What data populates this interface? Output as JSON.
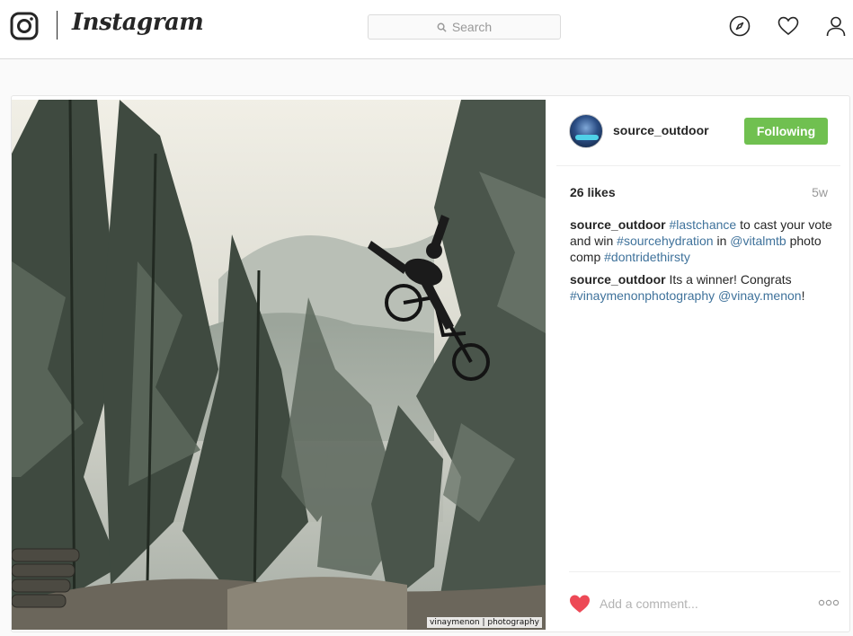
{
  "header": {
    "wordmark": "Instagram",
    "search": {
      "placeholder": "Search"
    }
  },
  "post": {
    "image_credit": "vinaymenon | photography",
    "author": "source_outdoor",
    "follow_label": "Following",
    "likes": "26 likes",
    "age": "5w",
    "comments": [
      {
        "user": "source_outdoor",
        "parts": [
          {
            "text": "#lastchance",
            "link": true
          },
          {
            "text": " to cast your vote and win ",
            "link": false
          },
          {
            "text": "#sourcehydration",
            "link": true
          },
          {
            "text": " in ",
            "link": false
          },
          {
            "text": "@vitalmtb",
            "link": true
          },
          {
            "text": " photo comp ",
            "link": false
          },
          {
            "text": "#dontridethirsty",
            "link": true
          }
        ]
      },
      {
        "user": "source_outdoor",
        "parts": [
          {
            "text": "Its a winner! Congrats ",
            "link": false
          },
          {
            "text": "#vinaymenonphotography",
            "link": true
          },
          {
            "text": " ",
            "link": false
          },
          {
            "text": "@vinay.menon",
            "link": true
          },
          {
            "text": "!",
            "link": false
          }
        ]
      }
    ],
    "add_comment_placeholder": "Add a comment..."
  },
  "colors": {
    "follow_button": "#70c050",
    "link": "#3f729b",
    "liked_heart": "#ed4956"
  },
  "icons": [
    "instagram-logo-icon",
    "search-icon",
    "compass-icon",
    "heart-icon",
    "profile-icon",
    "heart-filled-icon",
    "more-options-icon"
  ]
}
